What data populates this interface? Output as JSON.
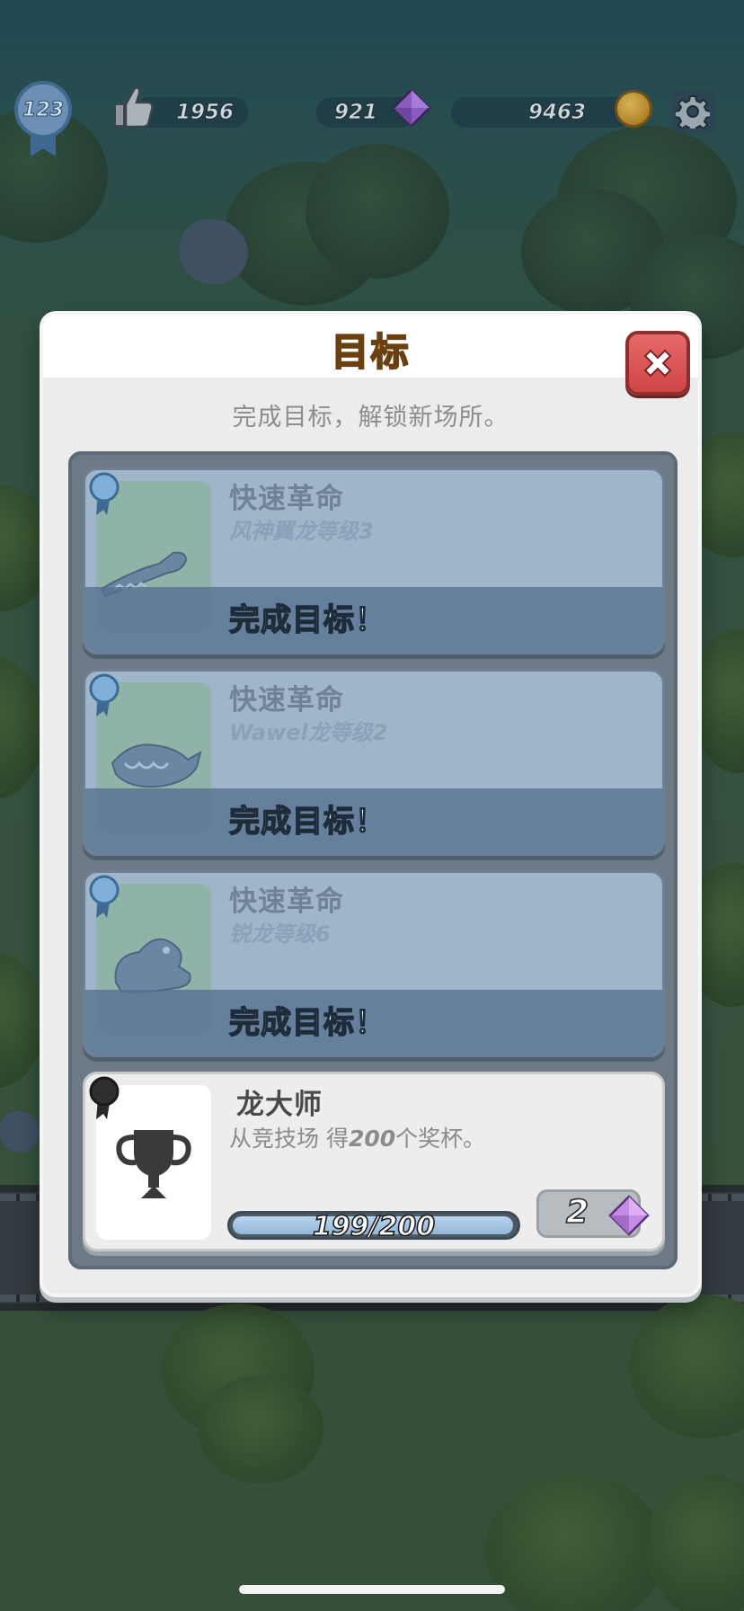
{
  "hud": {
    "level": "123",
    "likes": "1956",
    "gems": "921",
    "coins": "9463"
  },
  "modal": {
    "title": "目标",
    "subtitle": "完成目标，解锁新场所。",
    "goals": [
      {
        "name": "快速革命",
        "requirement": "风神翼龙等级3",
        "status": "完成目标！"
      },
      {
        "name": "快速革命",
        "requirement": "Wawel龙等级2",
        "status": "完成目标！"
      },
      {
        "name": "快速革命",
        "requirement": "锐龙等级6",
        "status": "完成目标！"
      }
    ],
    "final_goal": {
      "name": "龙大师",
      "desc_prefix": "从竞技场 得",
      "desc_number": "200",
      "desc_suffix": "个奖杯。",
      "progress_text": "199/200",
      "progress_fraction": 0.995,
      "reward": "2"
    }
  },
  "colors": {
    "title": "#f3a630",
    "close": "#cf4545",
    "gem": "#b37ad8"
  }
}
